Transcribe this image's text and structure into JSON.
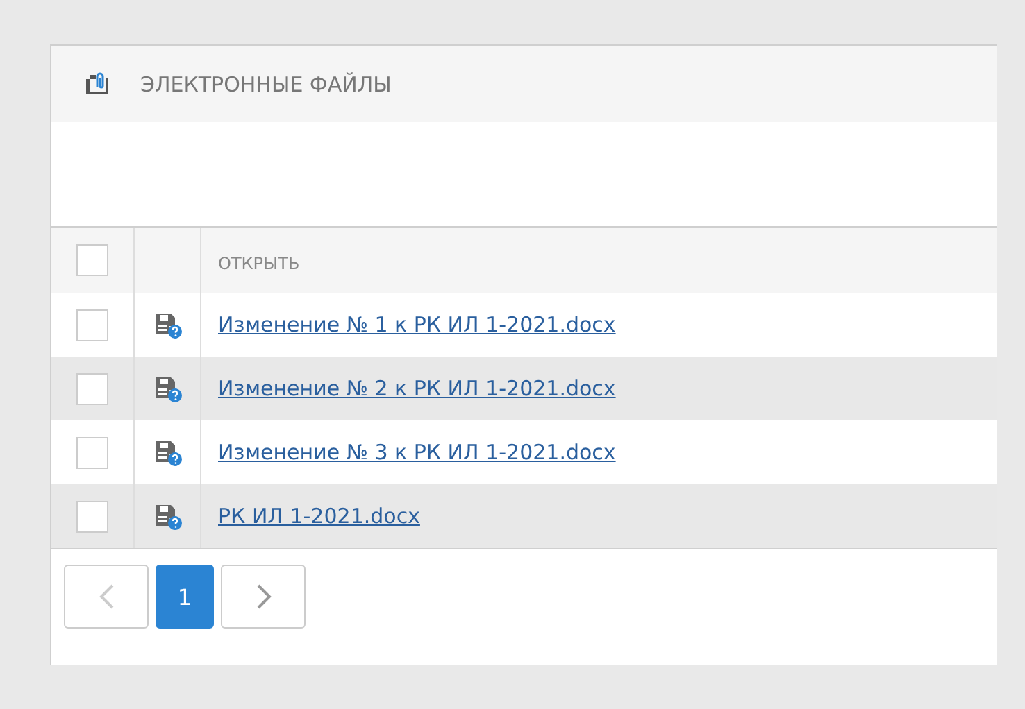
{
  "panel": {
    "title": "ЭЛЕКТРОННЫЕ ФАЙЛЫ"
  },
  "table": {
    "header_checked": false,
    "columns": [
      "ОТКРЫТЬ"
    ],
    "rows": [
      {
        "checked": false,
        "file": "Изменение № 1 к РК ИЛ 1-2021.docx"
      },
      {
        "checked": false,
        "file": "Изменение № 2 к РК ИЛ 1-2021.docx"
      },
      {
        "checked": false,
        "file": "Изменение № 3 к РК ИЛ 1-2021.docx"
      },
      {
        "checked": false,
        "file": "РК ИЛ 1-2021.docx"
      }
    ]
  },
  "pagination": {
    "prev_disabled": true,
    "next_disabled": false,
    "pages": [
      {
        "label": "1",
        "selected": true
      }
    ]
  }
}
